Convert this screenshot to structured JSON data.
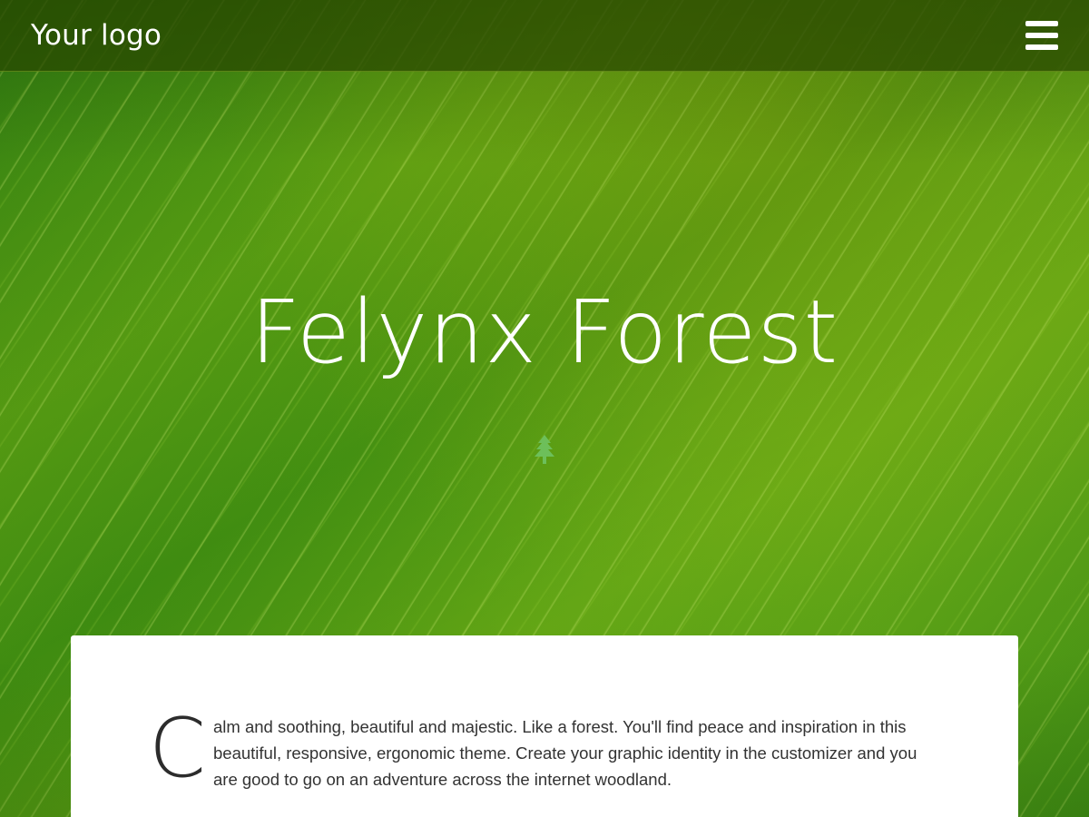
{
  "header": {
    "logo_text": "Your logo",
    "menu_icon": "hamburger-menu-icon"
  },
  "hero": {
    "title": "Felynx Forest",
    "icon": "tree-icon",
    "icon_color": "#6dbf5a"
  },
  "content": {
    "dropcap": "C",
    "intro_text": "alm and soothing, beautiful and majestic. Like a forest. You'll find peace and inspiration in this beautiful, responsive, ergonomic theme. Create your graphic identity in the customizer and you are good to go on an adventure across the internet woodland."
  },
  "colors": {
    "header_bg": "#2f4f00",
    "leaf_green": "#4f9a12",
    "card_bg": "#ffffff",
    "text": "#333333"
  }
}
